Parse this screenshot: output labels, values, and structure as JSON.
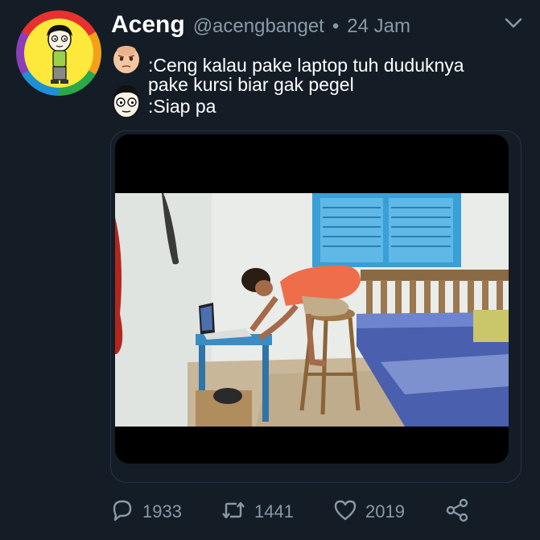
{
  "tweet": {
    "author_name": "Aceng",
    "author_handle": "@acengbanget",
    "separator": "•",
    "time": "24 Jam",
    "lines": [
      ":Ceng kalau pake laptop tuh duduknya",
      " pake kursi biar gak pegel",
      ":Siap pa"
    ]
  },
  "media": {
    "icons": {
      "avatar": "aceng-avatar",
      "father_emoji": "boss-baby-face-icon",
      "aceng_emoji": "aceng-face-icon"
    }
  },
  "actions": {
    "reply_count": "1933",
    "retweet_count": "1441",
    "like_count": "2019"
  },
  "colors": {
    "background": "#141d26",
    "secondary_text": "#8899a6",
    "border": "#243447"
  }
}
